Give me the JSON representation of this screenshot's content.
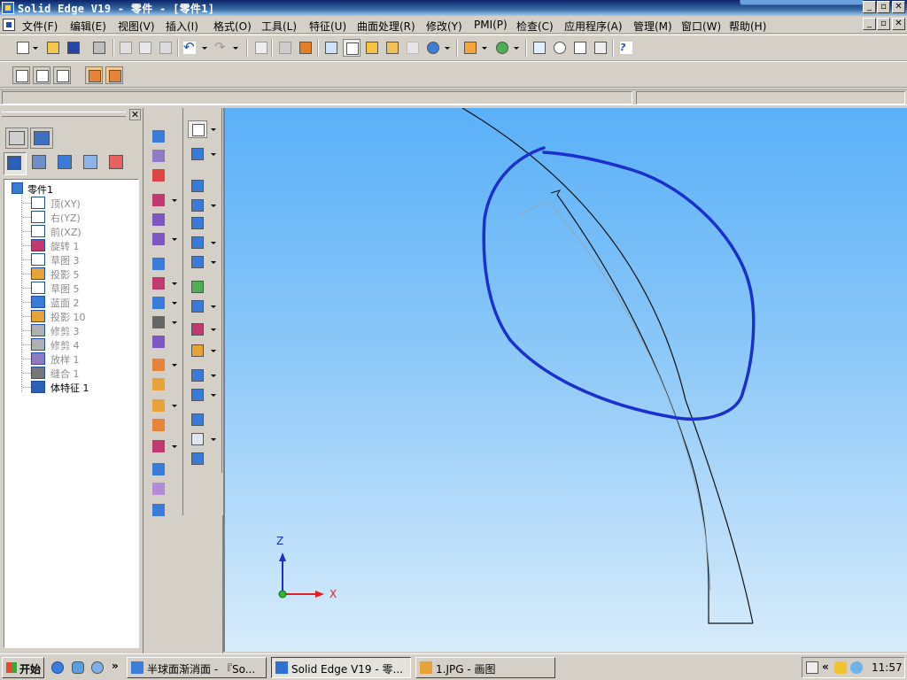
{
  "window": {
    "title": "Solid Edge V19 - 零件 - [零件1]"
  },
  "menu": [
    "文件(F)",
    "编辑(E)",
    "视图(V)",
    "插入(I)",
    "格式(O)",
    "工具(L)",
    "特征(U)",
    "曲面处理(R)",
    "修改(Y)",
    "PMI(P)",
    "检查(C)",
    "应用程序(A)",
    "管理(M)",
    "窗口(W)",
    "帮助(H)"
  ],
  "tree": {
    "root": "零件1",
    "items": [
      {
        "label": "顶(XY)",
        "icon": "plane-icon"
      },
      {
        "label": "右(YZ)",
        "icon": "plane-icon"
      },
      {
        "label": "前(XZ)",
        "icon": "plane-icon"
      },
      {
        "label": "旋转 1",
        "icon": "revolve-icon"
      },
      {
        "label": "草图 3",
        "icon": "sketch-icon"
      },
      {
        "label": "投影 5",
        "icon": "projection-icon"
      },
      {
        "label": "草图 5",
        "icon": "sketch-icon"
      },
      {
        "label": "蓝面 2",
        "icon": "bluesurf-icon"
      },
      {
        "label": "投影 10",
        "icon": "projection-icon"
      },
      {
        "label": "修剪 3",
        "icon": "trim-icon"
      },
      {
        "label": "修剪 4",
        "icon": "trim-icon"
      },
      {
        "label": "放样 1",
        "icon": "loft-icon"
      },
      {
        "label": "缝合 1",
        "icon": "stitch-icon"
      },
      {
        "label": "体特征 1",
        "icon": "body-feature-icon"
      }
    ]
  },
  "axes": {
    "z": "Z",
    "x": "X"
  },
  "taskbar": {
    "start": "开始",
    "tasks": [
      {
        "label": "半球面渐消面 - 『So...",
        "active": false
      },
      {
        "label": "Solid Edge V19 - 零...",
        "active": true
      },
      {
        "label": "1.JPG - 画图",
        "active": false
      }
    ],
    "overflow": "»",
    "clock": "11:57"
  },
  "colors": {
    "accent_blue": "#1b2fcf",
    "title_bar": "#0a246a"
  }
}
